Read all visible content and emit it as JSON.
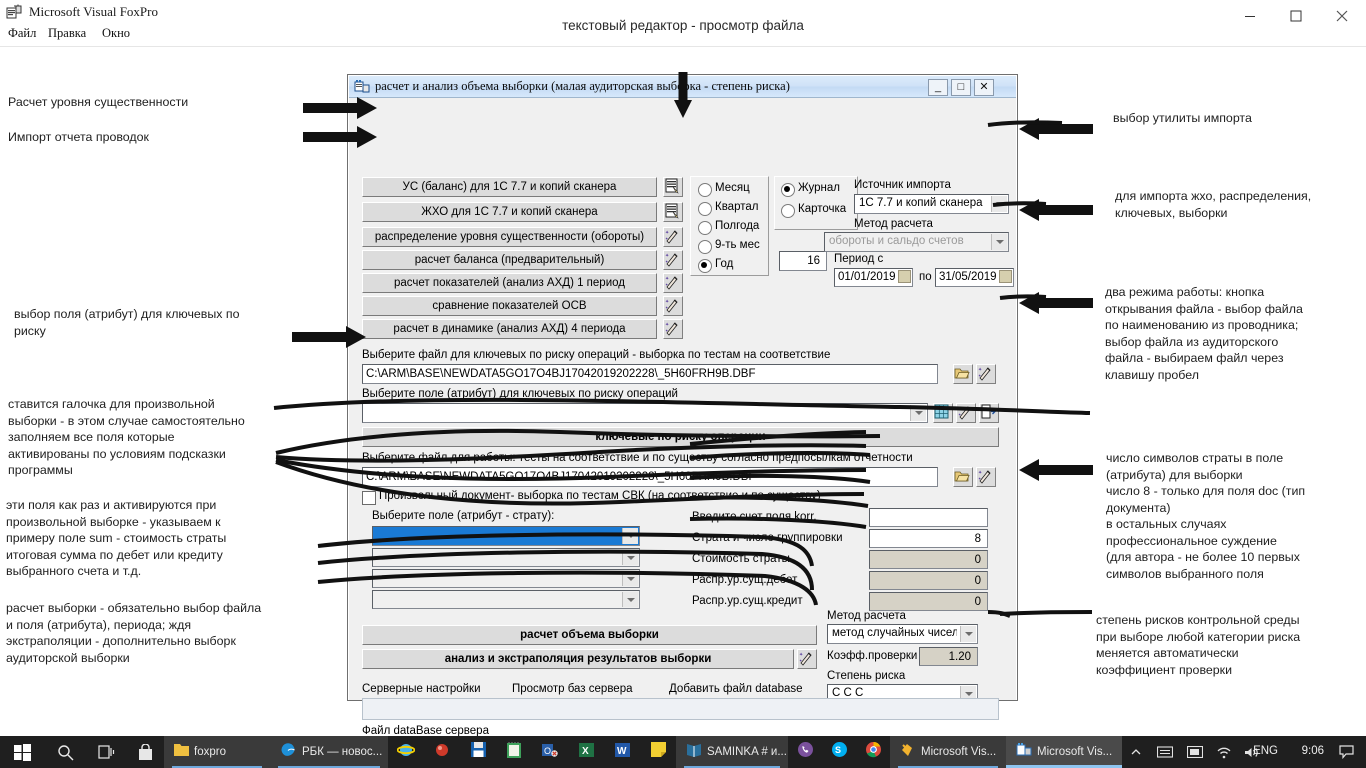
{
  "host_window": {
    "title": "Microsoft Visual FoxPro",
    "icon": "foxpro-app-icon",
    "menus": [
      "Файл",
      "Правка",
      "Окно"
    ],
    "buttons": {
      "minimize": "minimize-icon",
      "maximize": "maximize-icon",
      "close": "close-icon"
    },
    "document_caption": "текстовый редактор - просмотр файла"
  },
  "dialog": {
    "title": "расчет и анализ объема выборки (малая аудиторская выборка - степень риска)",
    "title_buttons": {
      "minimize": "_",
      "maximize": "□",
      "close": "✕"
    },
    "action_buttons": [
      {
        "label": "УС (баланс) для 1С 7.7 и копий сканера",
        "icon": "import-list-icon"
      },
      {
        "label": "ЖХО для 1С 7.7 и копий сканера",
        "icon": "import-list-icon"
      },
      {
        "label": "распределение уровня существенности (обороты)",
        "icon": "magic-wand-icon"
      },
      {
        "label": "расчет баланса (предварительный)",
        "icon": "magic-wand-icon"
      },
      {
        "label": "расчет показателей (анализ АХД) 1 период",
        "icon": "magic-wand-icon"
      },
      {
        "label": "сравнение показателей ОСВ",
        "icon": "magic-wand-icon"
      },
      {
        "label": "расчет в динамике (анализ АХД) 4 периода",
        "icon": "magic-wand-icon"
      }
    ],
    "period_radios": [
      {
        "label": "Месяц",
        "selected": false
      },
      {
        "label": "Квартал",
        "selected": false
      },
      {
        "label": "Полгода",
        "selected": false
      },
      {
        "label": "9-ть мес",
        "selected": false
      },
      {
        "label": "Год",
        "selected": true
      }
    ],
    "doc_radios": [
      {
        "label": "Журнал",
        "selected": true
      },
      {
        "label": "Карточка",
        "selected": false
      }
    ],
    "year_value": "16",
    "import_source": {
      "label": "Источник импорта",
      "value": "1С 7.7 и копий сканера"
    },
    "calc_method_top": {
      "label": "Метод расчета",
      "value": "обороты и сальдо счетов",
      "disabled": true
    },
    "period": {
      "label": "Период  с",
      "from": "01/01/2019",
      "to": "31/05/2019",
      "between": "по"
    },
    "key_risk": {
      "file_label": "Выберите файл для ключевых по риску операций - выборка по тестам на соответствие",
      "file_value": "C:\\ARM\\BASE\\NEWDATA5GO17O4BJ17042019202228\\_5H60FRH9B.DBF",
      "field_label": "Выберите поле  (атрибут) для ключевых по риску операций",
      "field_value": "",
      "open_icon": "open-folder-icon",
      "wand_icon": "magic-wand-icon",
      "grid_icon": "grid-table-icon",
      "exit_icon": "exit-door-icon",
      "run_button": "ключевые по риску операции"
    },
    "work_file": {
      "label": "Выберите файл для работы: тесты на соответствие и по существу согласно предпосылкам отчетности",
      "value": "C:\\ARM\\BASE\\NEWDATA5GO17O4BJ17042019202228\\_5H60FRH9B.DBF",
      "open_icon": "open-folder-icon",
      "wand_icon": "magic-wand-icon"
    },
    "free_doc_checkbox": "Произвольный документ- выборка по тестам СВК (на соответствие и по существу)",
    "field_strata": {
      "label": "Выберите поле (атрибут - страту):",
      "selected_value": "",
      "empty_rows": 3
    },
    "params": [
      {
        "label": "Введите счет поля korr.",
        "value": "",
        "readonly": false
      },
      {
        "label": "Страта и число группировки",
        "value": "8",
        "readonly": false
      },
      {
        "label": "Стоимость страты",
        "value": "0",
        "readonly": true
      },
      {
        "label": "Распр.ур.сущ.дебет",
        "value": "0",
        "readonly": true
      },
      {
        "label": "Распр.ур.сущ.кредит",
        "value": "0",
        "readonly": true
      }
    ],
    "calc_sample_button": "расчет объема выборки",
    "analysis_button": "анализ и экстраполяция результатов выборки",
    "analysis_icon": "magic-wand-icon",
    "calc_method": {
      "label": "Метод расчета",
      "value": "метод случайных чисел"
    },
    "check_coeff": {
      "label": "Коэфф.проверки",
      "value": "1.20"
    },
    "risk_degree": {
      "label": "Степень риска",
      "value": "С С С"
    },
    "server_links": [
      "Серверные настройки",
      "Просмотр баз сервера",
      "Добавить файл database"
    ],
    "server_field_value": "",
    "db_file_label": "Файл dataBase сервера",
    "db_file_value": ""
  },
  "annotations": {
    "left": [
      {
        "text": "Расчет уровня существенности"
      },
      {
        "text": "Импорт отчета проводок"
      },
      {
        "text": "выбор поля (атрибут) для ключевых по\nриску"
      },
      {
        "text": "ставится галочка для произвольной\nвыборки - в этом случае самостоятельно\nзаполняем все поля которые\nактивированы по условиям подсказки\nпрограммы"
      },
      {
        "text": "эти поля как раз и активируются при\nпроизвольной выборке - указываем к\nпримеру поле sum - стоимость страты\nитоговая сумма по дебет или кредиту\nвыбранного счета и т.д."
      },
      {
        "text": "расчет выборки - обязательно выбор файла\nи поля (атрибута), периода; ждя\nэкстраполяции - дополнительно выборк\nаудиторской выборки"
      }
    ],
    "right": [
      {
        "text": "выбор утилиты импорта"
      },
      {
        "text": "для импорта жхо, распределения,\nключевых, выборки"
      },
      {
        "text": "два режима работы: кнопка\nоткрывания файла - выбор файла\nпо наименованию из проводника;\nвыбор файла из аудиторского\nфайла - выбираем файл через\nклавишу пробел"
      },
      {
        "text": "число символов страты в поле\n(атрибута) для выборки\nчисло 8 - только для поля doc (тип\nдокумента)\nв остальных случаях\nпрофессиональное суждение\n(для автора - не более 10 первых\nсимволов выбранного поля"
      },
      {
        "text": "степень рисков контрольной среды\nпри выборе любой категории риска\nменяется автоматически\nкоэффициент проверки"
      }
    ]
  },
  "taskbar": {
    "start": "windows-start-icon",
    "search": "search-icon",
    "taskview": "task-view-icon",
    "store": "store-icon",
    "items": [
      {
        "label": "foxpro",
        "icon": "folder-icon",
        "active": true
      },
      {
        "label": "РБК — новос...",
        "icon": "edge-icon",
        "active": true
      },
      {
        "label": "",
        "icon": "internet-explorer-icon",
        "active": false
      },
      {
        "label": "",
        "icon": "red-ball-icon",
        "active": false
      },
      {
        "label": "",
        "icon": "save-disk-icon",
        "active": false
      },
      {
        "label": "",
        "icon": "notepad-icon",
        "active": false
      },
      {
        "label": "",
        "icon": "outlook-icon",
        "active": false
      },
      {
        "label": "",
        "icon": "excel-icon",
        "active": false
      },
      {
        "label": "",
        "icon": "word-icon",
        "active": false
      },
      {
        "label": "",
        "icon": "sticky-notes-icon",
        "active": false
      },
      {
        "label": "SAMINKA # и...",
        "icon": "book-icon",
        "active": true
      },
      {
        "label": "",
        "icon": "viber-icon",
        "active": false
      },
      {
        "label": "",
        "icon": "skype-icon",
        "active": false
      },
      {
        "label": "",
        "icon": "chrome-icon",
        "active": false
      },
      {
        "label": "Microsoft Vis...",
        "icon": "foxpro-icon",
        "active": true
      },
      {
        "label": "Microsoft Vis...",
        "icon": "foxpro-icon",
        "active": true,
        "focused": true
      }
    ],
    "tray": {
      "chevron": "chevron-up-icon",
      "keyboard": "keyboard-icon",
      "display": "display-icon",
      "wifi": "wifi-icon",
      "volume": "volume-icon",
      "language": "ENG",
      "clock": "9:06",
      "notifications": "notification-icon"
    }
  }
}
